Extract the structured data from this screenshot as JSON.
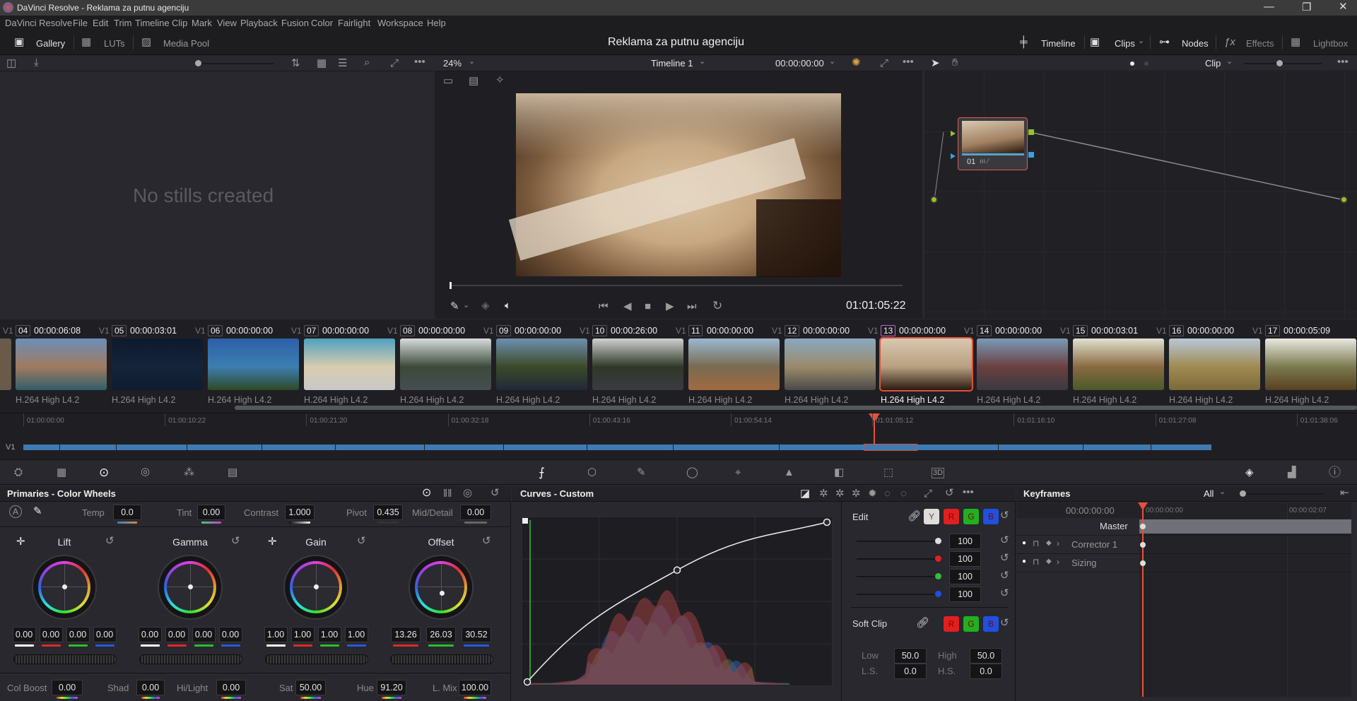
{
  "window": {
    "title": "DaVinci Resolve - Reklama za putnu agenciju"
  },
  "menu": [
    "DaVinci Resolve",
    "File",
    "Edit",
    "Trim",
    "Timeline",
    "Clip",
    "Mark",
    "View",
    "Playback",
    "Fusion",
    "Color",
    "Fairlight",
    "Workspace",
    "Help"
  ],
  "toolbar": {
    "gallery": "Gallery",
    "luts": "LUTs",
    "media_pool": "Media Pool",
    "project_title": "Reklama za putnu agenciju",
    "timeline": "Timeline",
    "clips": "Clips",
    "nodes": "Nodes",
    "effects": "Effects",
    "lightbox": "Lightbox"
  },
  "gallery": {
    "empty_text": "No stills created"
  },
  "viewer": {
    "zoom": "24%",
    "timeline_name": "Timeline 1",
    "timecode_top": "00:00:00:00",
    "timecode": "01:01:05:22",
    "playhead_fraction": 0.0
  },
  "nodes": {
    "mode": "Clip",
    "node_label": "01"
  },
  "clips": [
    {
      "num": "04",
      "tc": "00:00:06:08",
      "track": "V1",
      "codec": "H.264 High L4.2",
      "colors": [
        "#6a8fb8",
        "#a07a60",
        "#2f5f6a"
      ]
    },
    {
      "num": "05",
      "tc": "00:00:03:01",
      "track": "V1",
      "codec": "H.264 High L4.2",
      "colors": [
        "#0e1a2c",
        "#14243a",
        "#101c2e"
      ]
    },
    {
      "num": "06",
      "tc": "00:00:00:00",
      "track": "V1",
      "codec": "H.264 High L4.2",
      "colors": [
        "#2e5fa8",
        "#3c7eb0",
        "#2e4a26"
      ]
    },
    {
      "num": "07",
      "tc": "00:00:00:00",
      "track": "V1",
      "codec": "H.264 High L4.2",
      "colors": [
        "#4fa0c0",
        "#d9cdb0",
        "#c8c8c8"
      ]
    },
    {
      "num": "08",
      "tc": "00:00:00:00",
      "track": "V1",
      "codec": "H.264 High L4.2",
      "colors": [
        "#d8dcdc",
        "#3c4a3a",
        "#454d52"
      ]
    },
    {
      "num": "09",
      "tc": "00:00:00:00",
      "track": "V1",
      "codec": "H.264 High L4.2",
      "colors": [
        "#6f8fb0",
        "#3c4a28",
        "#20283a"
      ]
    },
    {
      "num": "10",
      "tc": "00:00:26:00",
      "track": "V1",
      "codec": "H.264 High L4.2",
      "colors": [
        "#d0d0d0",
        "#303828",
        "#3a3a40"
      ]
    },
    {
      "num": "11",
      "tc": "00:00:00:00",
      "track": "V1",
      "codec": "H.264 High L4.2",
      "colors": [
        "#9ab8d0",
        "#7a6a50",
        "#a06a40"
      ]
    },
    {
      "num": "12",
      "tc": "00:00:00:00",
      "track": "V1",
      "codec": "H.264 High L4.2",
      "colors": [
        "#8aa8c0",
        "#9a8a6a",
        "#4a4a4a"
      ]
    },
    {
      "num": "13",
      "tc": "00:00:00:00",
      "track": "V1",
      "codec": "H.264 High L4.2",
      "colors": [
        "#d8c8b0",
        "#b8a080",
        "#2a1a10"
      ],
      "selected": true
    },
    {
      "num": "14",
      "tc": "00:00:00:00",
      "track": "V1",
      "codec": "H.264 High L4.2",
      "colors": [
        "#7a9ab8",
        "#6a4040",
        "#3a3a40"
      ]
    },
    {
      "num": "15",
      "tc": "00:00:03:01",
      "track": "V1",
      "codec": "H.264 High L4.2",
      "colors": [
        "#e0e0d0",
        "#8a6a40",
        "#4a5a2a"
      ]
    },
    {
      "num": "16",
      "tc": "00:00:00:00",
      "track": "V1",
      "codec": "H.264 High L4.2",
      "colors": [
        "#b8c8d8",
        "#a08a50",
        "#7a6a3a"
      ]
    },
    {
      "num": "17",
      "tc": "00:00:05:09",
      "track": "V1",
      "codec": "H.264 High L4.2",
      "colors": [
        "#e8e8e0",
        "#7a7a50",
        "#5a4020"
      ]
    }
  ],
  "timeline": {
    "track": "V1",
    "ruler": [
      "01:00:00:00",
      "01:00:10:22",
      "01:00:21:20",
      "01:00:32:18",
      "01:00:43:16",
      "01:00:54:14",
      "01:01:05:12",
      "01:01:16:10",
      "01:01:27:08",
      "01:01:38:06"
    ],
    "segments": [
      0,
      52,
      132,
      232,
      338,
      442,
      568,
      680,
      798,
      920,
      1070,
      1190,
      1265,
      1380,
      1500,
      1596,
      1682
    ]
  },
  "primaries": {
    "title": "Primaries - Color Wheels",
    "temp_label": "Temp",
    "temp": "0.0",
    "tint_label": "Tint",
    "tint": "0.00",
    "contrast_label": "Contrast",
    "contrast": "1.000",
    "pivot_label": "Pivot",
    "pivot": "0.435",
    "mid_label": "Mid/Detail",
    "mid": "0.00",
    "wheels": [
      {
        "name": "Lift",
        "values": [
          "0.00",
          "0.00",
          "0.00",
          "0.00"
        ]
      },
      {
        "name": "Gamma",
        "values": [
          "0.00",
          "0.00",
          "0.00",
          "0.00"
        ]
      },
      {
        "name": "Gain",
        "values": [
          "1.00",
          "1.00",
          "1.00",
          "1.00"
        ]
      },
      {
        "name": "Offset",
        "values": [
          "13.26",
          "26.03",
          "30.52"
        ]
      }
    ],
    "colboost_label": "Col Boost",
    "colboost": "0.00",
    "shad_label": "Shad",
    "shad": "0.00",
    "hilight_label": "Hi/Light",
    "hilight": "0.00",
    "sat_label": "Sat",
    "sat": "50.00",
    "hue_label": "Hue",
    "hue": "91.20",
    "lmix_label": "L. Mix",
    "lmix": "100.00"
  },
  "curves": {
    "title": "Curves - Custom",
    "edit_label": "Edit",
    "channels": [
      "Y",
      "R",
      "G",
      "B"
    ],
    "intensity": [
      "100",
      "100",
      "100",
      "100"
    ],
    "softclip_label": "Soft Clip",
    "softclip_channels": [
      "R",
      "G",
      "B"
    ],
    "low_label": "Low",
    "low": "50.0",
    "high_label": "High",
    "high": "50.0",
    "ls_label": "L.S.",
    "ls": "0.0",
    "hs_label": "H.S.",
    "hs": "0.0",
    "points": [
      [
        0,
        0
      ],
      [
        0.5,
        0.7
      ],
      [
        1,
        1
      ]
    ]
  },
  "keyframes": {
    "title": "Keyframes",
    "filter": "All",
    "timecode": "00:00:00:00",
    "ruler": [
      "00:00:00:00",
      "00:00:02:07"
    ],
    "rows": [
      "Master",
      "Corrector 1",
      "Sizing"
    ]
  },
  "colors": {
    "accent": "#e8503a",
    "panel": "#28282e",
    "track_clip": "#3f7ab0"
  }
}
